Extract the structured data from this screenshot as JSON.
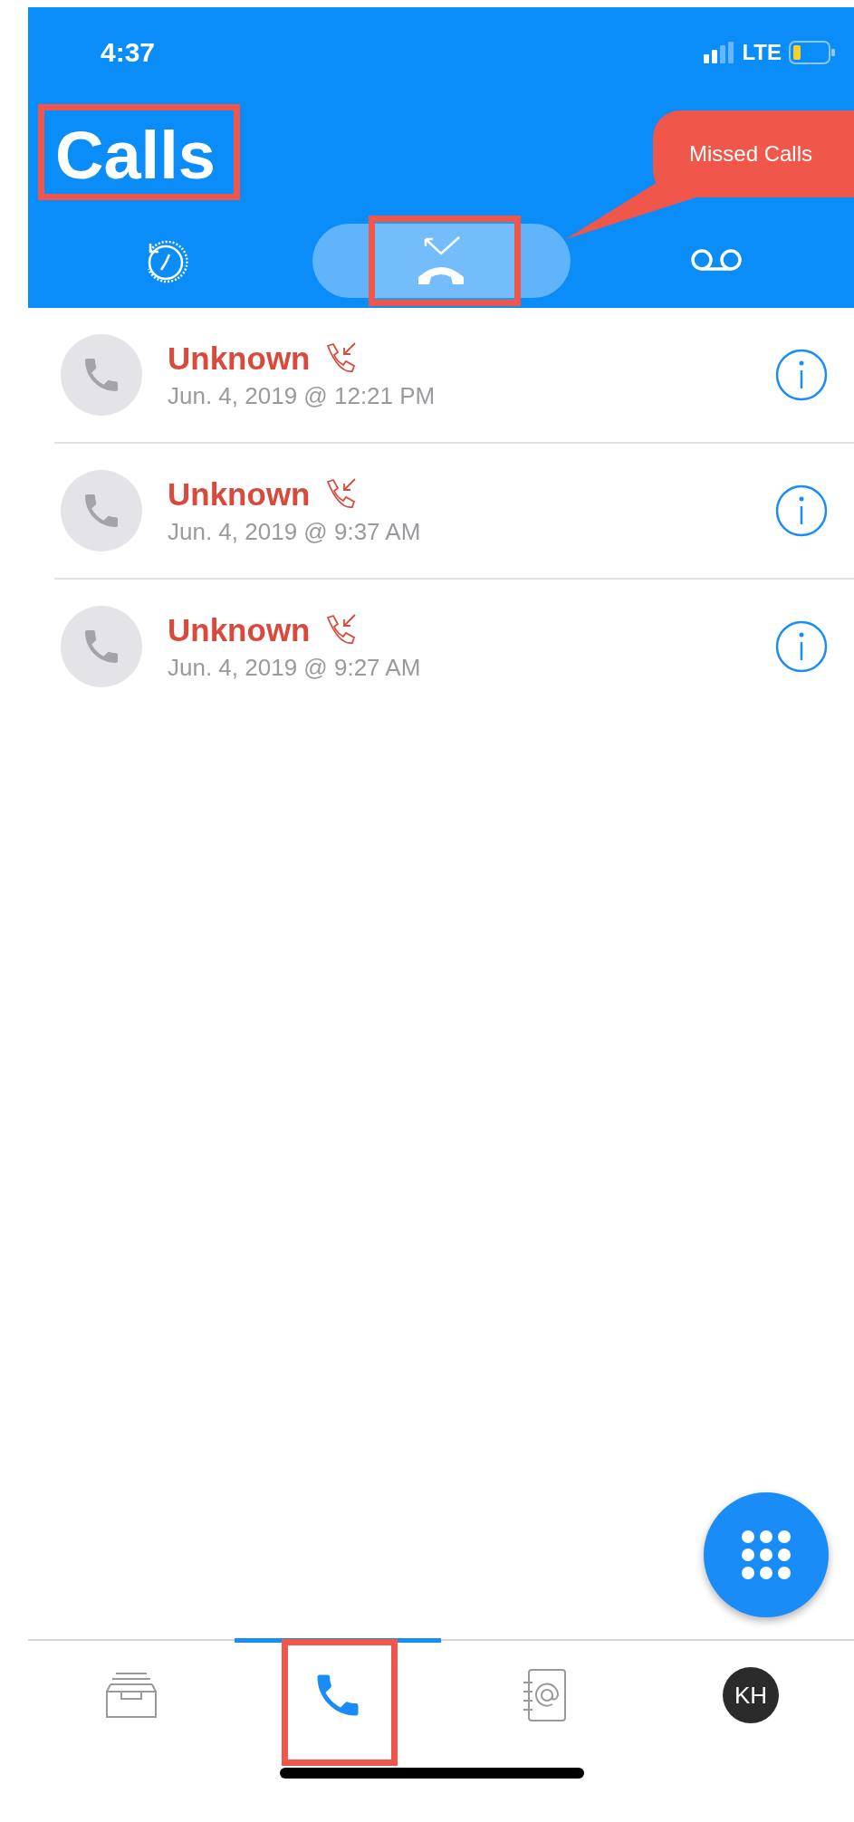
{
  "status_bar": {
    "time": "4:37",
    "network": "LTE"
  },
  "title": {
    "text": "Calls",
    "highlighted": true
  },
  "callout": {
    "text": "Missed Calls"
  },
  "header_tabs": [
    {
      "kind": "history",
      "selected": false,
      "highlighted": false
    },
    {
      "kind": "missed",
      "selected": true,
      "highlighted": true
    },
    {
      "kind": "voicemail",
      "selected": false,
      "highlighted": false
    }
  ],
  "calls": [
    {
      "name": "Unknown",
      "datetime": "Jun. 4, 2019 @ 12:21 PM"
    },
    {
      "name": "Unknown",
      "datetime": "Jun. 4, 2019 @ 9:37 AM"
    },
    {
      "name": "Unknown",
      "datetime": "Jun. 4, 2019 @ 9:27 AM"
    }
  ],
  "bottom_tabs": [
    {
      "kind": "inbox",
      "selected": false,
      "highlighted": false
    },
    {
      "kind": "calls",
      "selected": true,
      "highlighted": true
    },
    {
      "kind": "contacts",
      "selected": false,
      "highlighted": false
    },
    {
      "kind": "profile",
      "label": "KH",
      "selected": false,
      "highlighted": false
    }
  ]
}
